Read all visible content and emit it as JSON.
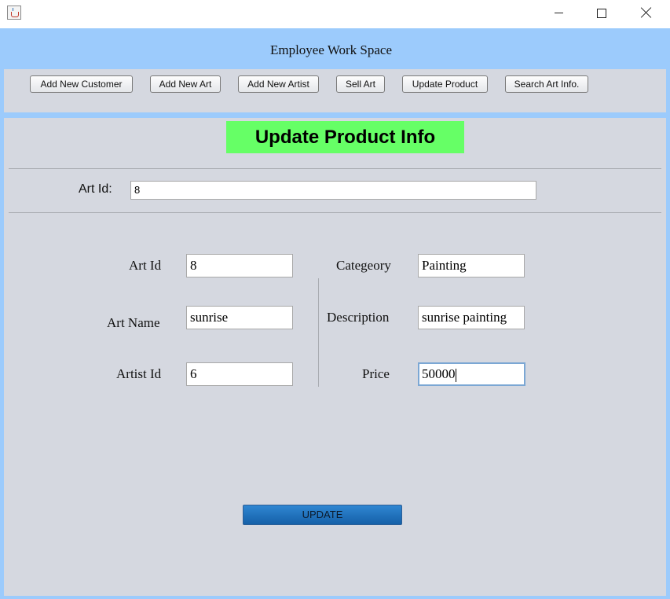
{
  "window": {
    "app_icon": "java-icon",
    "controls": [
      "minimize-icon",
      "maximize-icon",
      "close-icon"
    ]
  },
  "workspace_title": "Employee Work Space",
  "toolbar": {
    "buttons": [
      {
        "label": "Add New Customer"
      },
      {
        "label": "Add New Art"
      },
      {
        "label": "Add New Artist"
      },
      {
        "label": "Sell Art"
      },
      {
        "label": "Update Product"
      },
      {
        "label": "Search Art Info."
      }
    ]
  },
  "panel": {
    "heading": "Update Product Info",
    "search": {
      "label": "Art Id:",
      "value": "8"
    },
    "fields": {
      "art_id": {
        "label": "Art Id",
        "value": "8"
      },
      "art_name": {
        "label": "Art Name",
        "value": "sunrise"
      },
      "artist_id": {
        "label": "Artist Id",
        "value": "6"
      },
      "category": {
        "label": "Categeory",
        "value": "Painting"
      },
      "description": {
        "label": "Description",
        "value": "sunrise painting"
      },
      "price": {
        "label": "Price",
        "value": "50000"
      }
    },
    "update_label": "UPDATE"
  },
  "colors": {
    "frame": "#9ccbfc",
    "panel": "#d5d8e0",
    "heading_bg": "#66ff66",
    "update_button": "#1f74c0"
  }
}
